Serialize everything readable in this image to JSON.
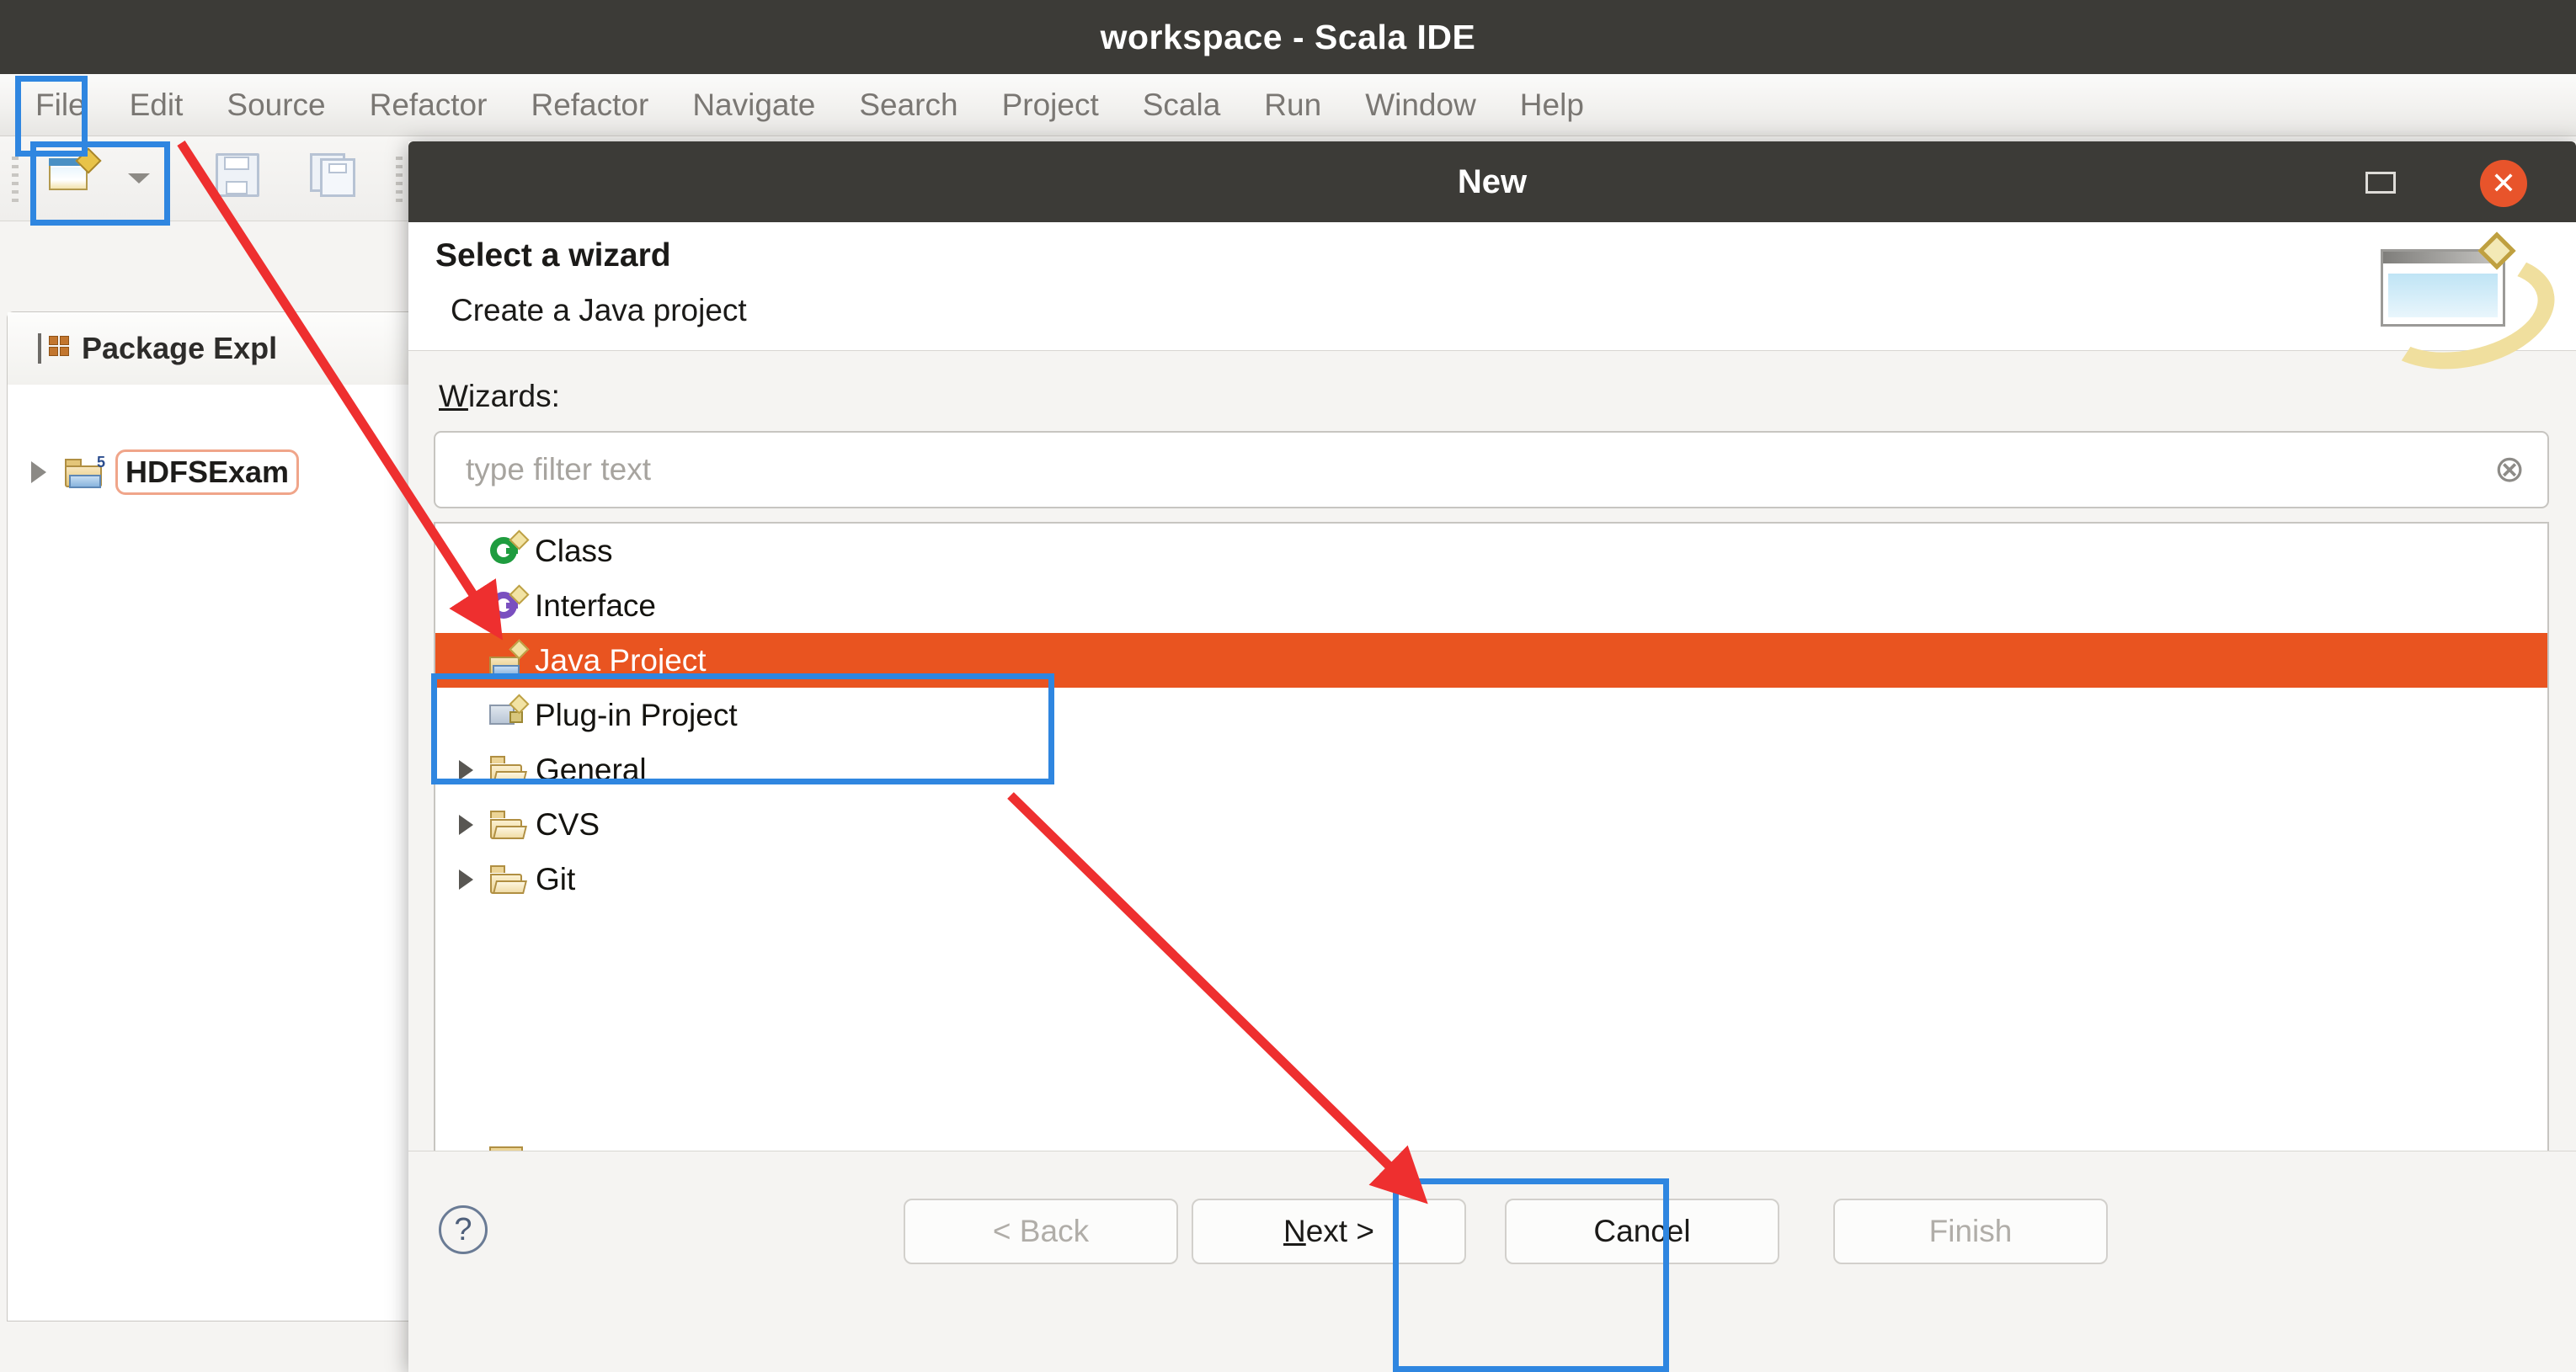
{
  "ide": {
    "title": "workspace - Scala IDE",
    "menu": [
      "File",
      "Edit",
      "Source",
      "Refactor",
      "Refactor",
      "Navigate",
      "Search",
      "Project",
      "Scala",
      "Run",
      "Window",
      "Help"
    ],
    "toolbar": {
      "new_icon": "new-window-icon",
      "new_dropdown_icon": "chevron-down-icon",
      "save_icon": "save-icon",
      "save_all_icon": "save-all-icon"
    },
    "explorer": {
      "title": "Package Expl",
      "icon": "package-explorer-icon",
      "project": "HDFSExam",
      "project_icon": "java-project-icon",
      "expander_icon": "triangle-right-icon"
    }
  },
  "dialog": {
    "title": "New",
    "maximize_icon": "maximize-icon",
    "close_icon": "close-icon",
    "header": {
      "title": "Select a wizard",
      "subtitle": "Create a Java project",
      "banner_icon": "wizard-banner-icon"
    },
    "wizards_label": "Wizards:",
    "wizards_label_mnemonic": "W",
    "filter": {
      "placeholder": "type filter text",
      "value": "",
      "clear_icon": "clear-circle-icon"
    },
    "tree": [
      {
        "label": "Class",
        "icon": "java-class-icon",
        "type": "leaf",
        "selected": false
      },
      {
        "label": "Interface",
        "icon": "java-interface-icon",
        "type": "leaf",
        "selected": false
      },
      {
        "label": "Java Project",
        "icon": "java-project-icon",
        "type": "leaf",
        "selected": true
      },
      {
        "label": "Plug-in Project",
        "icon": "plugin-project-icon",
        "type": "leaf",
        "selected": false
      },
      {
        "label": "General",
        "icon": "folder-icon",
        "type": "folder",
        "selected": false
      },
      {
        "label": "CVS",
        "icon": "folder-icon",
        "type": "folder",
        "selected": false
      },
      {
        "label": "Git",
        "icon": "folder-icon",
        "type": "folder",
        "selected": false
      }
    ],
    "footer": {
      "help_icon": "help-question-icon",
      "back": "< Back",
      "back_disabled": true,
      "next": "Next >",
      "next_mnemonic": "N",
      "cancel": "Cancel",
      "finish": "Finish",
      "finish_disabled": true
    }
  },
  "colors": {
    "selection_orange": "#e95420",
    "annotation_blue": "#2f86e0",
    "annotation_red": "#ee2f2f",
    "titlebar_dark": "#3c3b37",
    "close_button": "#e8542b"
  }
}
